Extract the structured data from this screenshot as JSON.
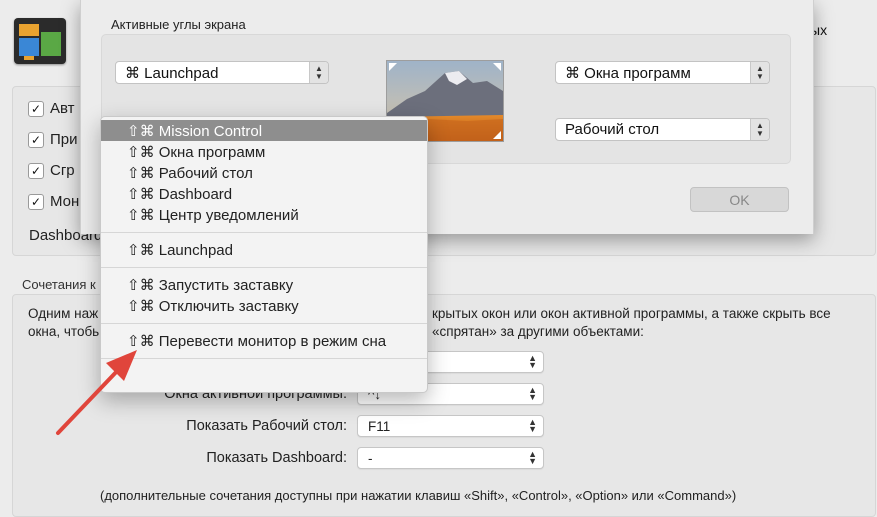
{
  "background": {
    "title_suffix": "ых",
    "checkboxes": [
      {
        "label": "Авт",
        "checked": true
      },
      {
        "label": "При",
        "checked": true
      },
      {
        "label": "Сгр",
        "checked": true
      },
      {
        "label": "Мон",
        "checked": true
      }
    ],
    "dashboard_label": "Dashboard",
    "shortcuts_title": "Сочетания к",
    "desc_line1_left": "Одним наж",
    "desc_line1_right": "крытых окон или окон активной программы, а также скрыть все",
    "desc_line2_left": "окна, чтобь",
    "desc_line2_right": "«спрятан» за другими объектами:",
    "rows": [
      {
        "label": "",
        "value": ""
      },
      {
        "label": "Окна активной программы:",
        "value": "^↓"
      },
      {
        "label": "Показать Рабочий стол:",
        "value": "F11"
      },
      {
        "label": "Показать Dashboard:",
        "value": "-"
      }
    ],
    "footer": "(дополнительные сочетания доступны при нажатии клавиш «Shift», «Control», «Option» или «Command»)"
  },
  "sheet": {
    "title": "Активные углы экрана",
    "top_left": "⌘ Launchpad",
    "top_right": "⌘ Окна программ",
    "bottom_right": "Рабочий стол",
    "ok_label": "OK"
  },
  "menu": {
    "items": [
      {
        "label": "⇧⌘ Mission Control",
        "highlighted": true
      },
      {
        "label": "⇧⌘ Окна программ"
      },
      {
        "label": "⇧⌘ Рабочий стол"
      },
      {
        "label": "⇧⌘ Dashboard"
      },
      {
        "label": "⇧⌘ Центр уведомлений"
      },
      {
        "label": "⇧⌘ Launchpad"
      },
      {
        "label": "⇧⌘ Запустить заставку"
      },
      {
        "label": "⇧⌘ Отключить заставку"
      },
      {
        "label": "⇧⌘ Перевести монитор в режим сна"
      }
    ]
  },
  "colors": {
    "highlight": "#8e8e8e",
    "arrow": "#e0453b"
  }
}
